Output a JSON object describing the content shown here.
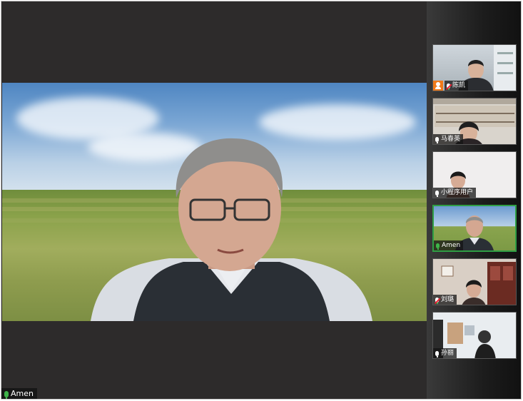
{
  "main": {
    "speaker_name": "Amen"
  },
  "participants": [
    {
      "name": "陈凯",
      "mic": "muted",
      "badge": "person-icon"
    },
    {
      "name": "马春英",
      "mic": "on"
    },
    {
      "name": "小程序用户",
      "mic": "on"
    },
    {
      "name": "Amen",
      "mic": "on",
      "active": true
    },
    {
      "name": "刘璐",
      "mic": "muted"
    },
    {
      "name": "孙丽",
      "mic": "on"
    }
  ],
  "colors": {
    "active_border": "#2f9e44",
    "mic_active": "#3fb44a",
    "badge": "#f07a1a"
  }
}
